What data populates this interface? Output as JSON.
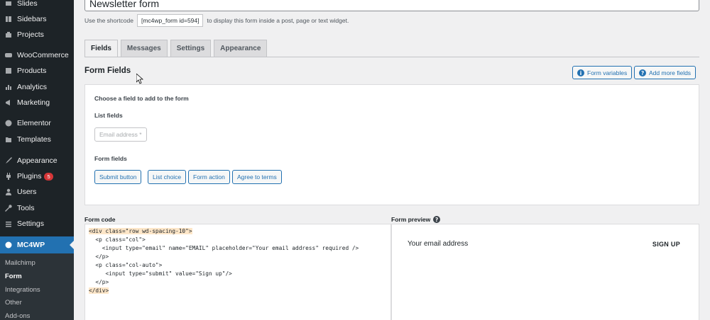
{
  "sidebar": {
    "items": [
      {
        "label": "Slides",
        "icon": "slides-icon"
      },
      {
        "label": "Sidebars",
        "icon": "sidebars-icon"
      },
      {
        "label": "Projects",
        "icon": "projects-icon"
      },
      {
        "label": "WooCommerce",
        "icon": "woocommerce-icon"
      },
      {
        "label": "Products",
        "icon": "products-icon"
      },
      {
        "label": "Analytics",
        "icon": "analytics-icon"
      },
      {
        "label": "Marketing",
        "icon": "marketing-icon"
      },
      {
        "label": "Elementor",
        "icon": "elementor-icon"
      },
      {
        "label": "Templates",
        "icon": "templates-icon"
      },
      {
        "label": "Appearance",
        "icon": "appearance-icon"
      },
      {
        "label": "Plugins",
        "icon": "plugins-icon",
        "badge": "5"
      },
      {
        "label": "Users",
        "icon": "users-icon"
      },
      {
        "label": "Tools",
        "icon": "tools-icon"
      },
      {
        "label": "Settings",
        "icon": "settings-icon"
      },
      {
        "label": "MC4WP",
        "icon": "mc4wp-icon",
        "active": true
      }
    ],
    "submenu": [
      "Mailchimp",
      "Form",
      "Integrations",
      "Other",
      "Add-ons"
    ]
  },
  "form": {
    "title": "Newsletter form",
    "shortcode_prefix": "Use the shortcode",
    "shortcode": "[mc4wp_form id=594]",
    "shortcode_suffix": "to display this form inside a post, page or text widget."
  },
  "tabs": [
    "Fields",
    "Messages",
    "Settings",
    "Appearance"
  ],
  "fields_section": {
    "title": "Form Fields",
    "form_variables_btn": "Form variables",
    "add_more_fields_btn": "Add more fields",
    "choose_heading": "Choose a field to add to the form",
    "list_fields_heading": "List fields",
    "email_field_btn": "Email address *",
    "form_fields_heading": "Form fields",
    "form_field_buttons": [
      "Submit button",
      "List choice",
      "Form action",
      "Agree to terms"
    ]
  },
  "code": {
    "label": "Form code",
    "lines": [
      "<div class=\"row wd-spacing-10\">",
      "  <p class=\"col\">",
      "    <input type=\"email\" name=\"EMAIL\" placeholder=\"Your email address\" required />",
      "  </p>",
      "  <p class=\"col-auto\">",
      "     <input type=\"submit\" value=\"Sign up\"/>",
      "  </p>",
      "</div>"
    ]
  },
  "preview": {
    "label": "Form preview",
    "email_placeholder": "Your email address",
    "signup_label": "SIGN UP"
  },
  "colors": {
    "sidebar_bg": "#1d2327",
    "accent": "#2271b1",
    "badge": "#d63638"
  }
}
